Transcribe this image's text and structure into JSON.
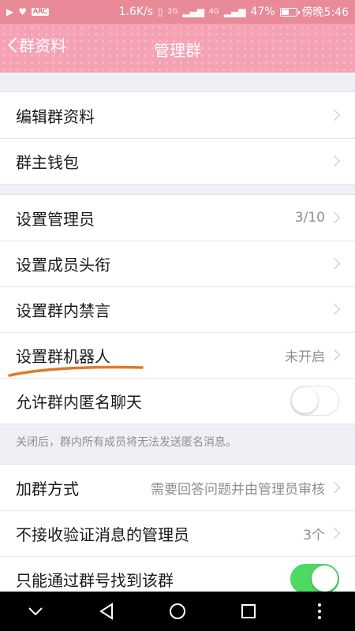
{
  "status": {
    "speed": "1.6K/s",
    "network_2g": "2G",
    "network_4g": "4G",
    "battery": "47%",
    "time": "傍晚5:46",
    "app_badge": "ARC"
  },
  "header": {
    "back_label": "群资料",
    "title": "管理群"
  },
  "group1": [
    {
      "label": "编辑群资料"
    },
    {
      "label": "群主钱包"
    }
  ],
  "group2": [
    {
      "label": "设置管理员",
      "value": "3/10"
    },
    {
      "label": "设置成员头衔"
    },
    {
      "label": "设置群内禁言"
    },
    {
      "label": "设置群机器人",
      "value": "未开启"
    },
    {
      "label": "允许群内匿名聊天",
      "toggle": false
    }
  ],
  "note": "关闭后，群内所有成员将无法发送匿名消息。",
  "group3": [
    {
      "label": "加群方式",
      "value": "需要回答问题并由管理员审核"
    },
    {
      "label": "不接收验证消息的管理员",
      "value": "3个"
    },
    {
      "label": "只能通过群号找到该群",
      "toggle": true
    }
  ],
  "colors": {
    "accent": "#f5a3b4",
    "toggle_on": "#4cd964",
    "annotation": "#e07a2a"
  }
}
